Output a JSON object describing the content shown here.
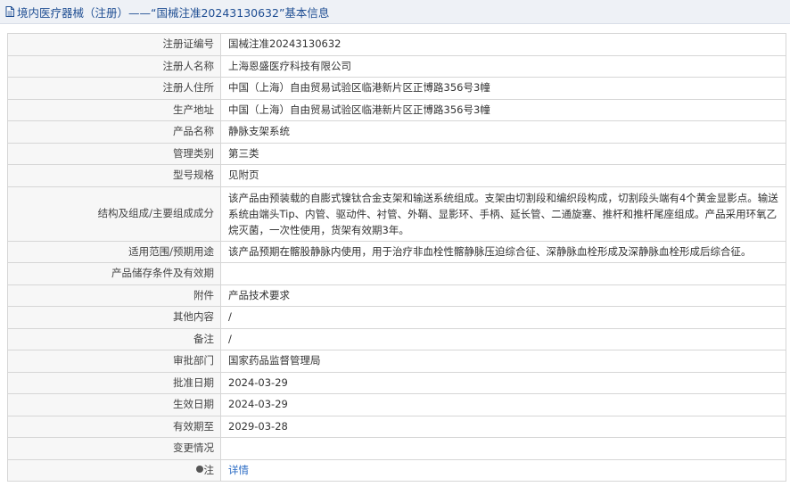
{
  "header": {
    "icon": "document-icon",
    "title": "境内医疗器械（注册）——“国械注准20243130632”基本信息"
  },
  "rows": [
    {
      "label": "注册证编号",
      "value": "国械注准20243130632"
    },
    {
      "label": "注册人名称",
      "value": "上海恩盛医疗科技有限公司"
    },
    {
      "label": "注册人住所",
      "value": "中国（上海）自由贸易试验区临港新片区正博路356号3幢"
    },
    {
      "label": "生产地址",
      "value": "中国（上海）自由贸易试验区临港新片区正博路356号3幢"
    },
    {
      "label": "产品名称",
      "value": "静脉支架系统"
    },
    {
      "label": "管理类别",
      "value": "第三类"
    },
    {
      "label": "型号规格",
      "value": "见附页"
    },
    {
      "label": "结构及组成/主要组成成分",
      "value": "该产品由预装载的自膨式镍钛合金支架和输送系统组成。支架由切割段和编织段构成，切割段头端有4个黄金显影点。输送系统由端头Tip、内管、驱动件、衬管、外鞘、显影环、手柄、延长管、二通旋塞、推杆和推杆尾座组成。产品采用环氧乙烷灭菌，一次性使用，货架有效期3年。"
    },
    {
      "label": "适用范围/预期用途",
      "value": "该产品预期在髂股静脉内使用，用于治疗非血栓性髂静脉压迫综合征、深静脉血栓形成及深静脉血栓形成后综合征。"
    },
    {
      "label": "产品储存条件及有效期",
      "value": ""
    },
    {
      "label": "附件",
      "value": "产品技术要求"
    },
    {
      "label": "其他内容",
      "value": "/"
    },
    {
      "label": "备注",
      "value": "/"
    },
    {
      "label": "审批部门",
      "value": "国家药品监督管理局"
    },
    {
      "label": "批准日期",
      "value": "2024-03-29"
    },
    {
      "label": "生效日期",
      "value": "2024-03-29"
    },
    {
      "label": "有效期至",
      "value": "2029-03-28"
    },
    {
      "label": "变更情况",
      "value": ""
    }
  ],
  "note_row": {
    "label": "注",
    "icon": "note-icon",
    "link_text": "详情"
  }
}
